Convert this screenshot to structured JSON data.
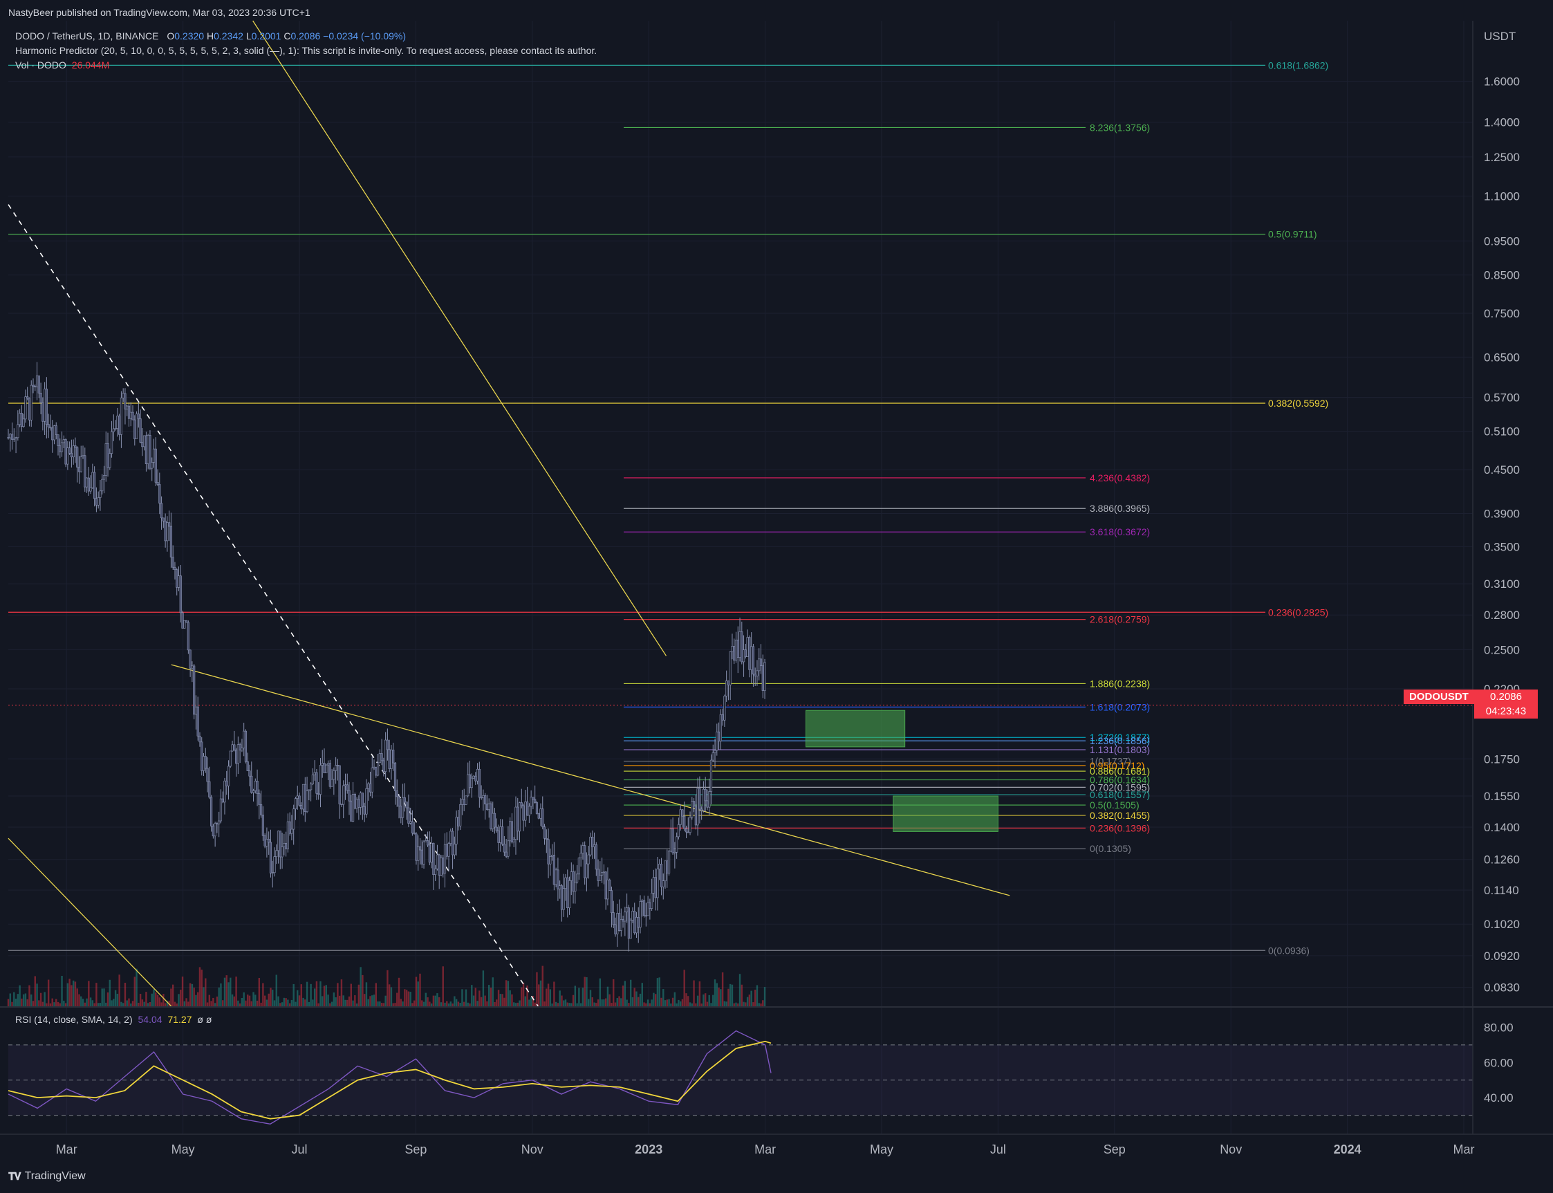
{
  "header": {
    "publish_line": "NastyBeer published on TradingView.com, Mar 03, 2023 20:36 UTC+1",
    "symbol_line": "DODO / TetherUS, 1D, BINANCE",
    "ohlc": {
      "o_label": "O",
      "o": "0.2320",
      "h_label": "H",
      "h": "0.2342",
      "l_label": "L",
      "l": "0.2001",
      "c_label": "C",
      "c": "0.2086",
      "chg": "−0.0234 (−10.09%)"
    },
    "indicator_line": "Harmonic Predictor (20, 5, 10, 0, 0, 5, 5, 5, 5, 5, 2, 3, solid (—), 1): This script is invite-only. To request access, please contact its author.",
    "vol_label": "Vol · DODO",
    "vol_value": "26.044M"
  },
  "rsi_legend": {
    "label": "RSI (14, close, SMA, 14, 2)",
    "rsi": "54.04",
    "sma": "71.27",
    "extra": "ø  ø"
  },
  "price_axis": {
    "currency": "USDT"
  },
  "last_price": {
    "symbol": "DODOUSDT",
    "price": "0.2086",
    "countdown": "04:23:43"
  },
  "footer": {
    "brand": "TradingView",
    "logo": "tradingview-logo-icon"
  },
  "colors": {
    "background": "#131722",
    "up": "#26a69a",
    "down": "#f23645",
    "candle_outline": "#8a93b2",
    "trendline": "#e8d44d",
    "rsi_line": "#7e57c2",
    "rsi_sma": "#f0d63c"
  },
  "chart_data": [
    {
      "type": "candlestick",
      "title": "DODO / TetherUS, 1D, BINANCE",
      "scale": "log",
      "ylim": [
        0.078,
        1.95
      ],
      "yticks": [
        1.6,
        1.4,
        1.25,
        1.1,
        0.95,
        0.85,
        0.75,
        0.65,
        0.57,
        0.51,
        0.45,
        0.39,
        0.35,
        0.31,
        0.28,
        0.25,
        0.22,
        0.175,
        0.155,
        0.14,
        0.126,
        0.114,
        0.102,
        0.092,
        0.083
      ],
      "ytick_labels": [
        "1.6000",
        "1.4000",
        "1.2500",
        "1.1000",
        "0.9500",
        "0.8500",
        "0.7500",
        "0.6500",
        "0.5700",
        "0.5100",
        "0.4500",
        "0.3900",
        "0.3500",
        "0.3100",
        "0.2800",
        "0.2500",
        "0.2200",
        "0.1750",
        "0.1550",
        "0.1400",
        "0.1260",
        "0.1140",
        "0.1020",
        "0.0920",
        "0.0830"
      ],
      "xtick_labels": [
        "Mar",
        "May",
        "Jul",
        "Sep",
        "Nov",
        "2023",
        "Mar",
        "May",
        "Jul",
        "Sep",
        "Nov",
        "2024",
        "Mar"
      ],
      "x_axis_months_from_feb_2022": [
        1,
        3,
        5,
        7,
        9,
        11,
        13,
        15,
        17,
        19,
        21,
        23,
        25
      ],
      "close_series_months": [
        0.0,
        0.5,
        1.0,
        1.5,
        2.0,
        2.5,
        3.0,
        3.5,
        4.0,
        4.5,
        5.0,
        5.5,
        6.0,
        6.5,
        7.0,
        7.5,
        8.0,
        8.5,
        9.0,
        9.5,
        10.0,
        10.5,
        11.0,
        11.5,
        12.0,
        12.5,
        13.0,
        13.1
      ],
      "close_series": [
        0.5,
        0.58,
        0.48,
        0.42,
        0.56,
        0.46,
        0.28,
        0.14,
        0.19,
        0.125,
        0.15,
        0.17,
        0.145,
        0.18,
        0.13,
        0.125,
        0.17,
        0.13,
        0.16,
        0.11,
        0.13,
        0.1,
        0.11,
        0.14,
        0.155,
        0.26,
        0.23,
        0.2086
      ],
      "fib_lines_long": [
        {
          "label": "0.618(1.6862)",
          "price": 1.6862,
          "color": "#26a69a"
        },
        {
          "label": "0.5(0.9711)",
          "price": 0.9711,
          "color": "#4caf50"
        },
        {
          "label": "0.382(0.5592)",
          "price": 0.5592,
          "color": "#f0d63c"
        },
        {
          "label": "0.236(0.2825)",
          "price": 0.2825,
          "color": "#f23645"
        },
        {
          "label": "0(0.0936)",
          "price": 0.0936,
          "color": "#787b86"
        }
      ],
      "fib_lines_short": [
        {
          "label": "8.236(1.3756)",
          "price": 1.3756,
          "color": "#4caf50"
        },
        {
          "label": "4.236(0.4382)",
          "price": 0.4382,
          "color": "#e91e63"
        },
        {
          "label": "3.886(0.3965)",
          "price": 0.3965,
          "color": "#b2b5be"
        },
        {
          "label": "3.618(0.3672)",
          "price": 0.3672,
          "color": "#9c27b0"
        },
        {
          "label": "2.618(0.2759)",
          "price": 0.2759,
          "color": "#f23645"
        },
        {
          "label": "1.886(0.2238)",
          "price": 0.2238,
          "color": "#cddc39"
        },
        {
          "label": "1.618(0.2073)",
          "price": 0.2073,
          "color": "#2962ff"
        },
        {
          "label": "1.272(0.1877)",
          "price": 0.1877,
          "color": "#00bcd4"
        },
        {
          "label": "1.236(0.1856)",
          "price": 0.1856,
          "color": "#5b9cf6"
        },
        {
          "label": "1.131(0.1803)",
          "price": 0.1803,
          "color": "#9575cd"
        },
        {
          "label": "1(0.1737)",
          "price": 0.1737,
          "color": "#787b86"
        },
        {
          "label": "0.95(0.1712)",
          "price": 0.1712,
          "color": "#ff9800"
        },
        {
          "label": "0.886(0.1681)",
          "price": 0.1681,
          "color": "#cddc39"
        },
        {
          "label": "0.786(0.1634)",
          "price": 0.1634,
          "color": "#4caf50"
        },
        {
          "label": "0.702(0.1595)",
          "price": 0.1595,
          "color": "#b2b5be"
        },
        {
          "label": "0.618(0.1557)",
          "price": 0.1557,
          "color": "#26a69a"
        },
        {
          "label": "0.5(0.1505)",
          "price": 0.1505,
          "color": "#4caf50"
        },
        {
          "label": "0.382(0.1455)",
          "price": 0.1455,
          "color": "#f0d63c"
        },
        {
          "label": "0.236(0.1396)",
          "price": 0.1396,
          "color": "#f23645"
        },
        {
          "label": "0(0.1305)",
          "price": 0.1305,
          "color": "#787b86"
        }
      ],
      "zones": [
        {
          "from_month": 13.7,
          "to_month": 15.4,
          "high": 0.205,
          "low": 0.182,
          "color": "#4caf50"
        },
        {
          "from_month": 15.2,
          "to_month": 17.0,
          "high": 0.155,
          "low": 0.138,
          "color": "#4caf50"
        }
      ]
    },
    {
      "type": "line",
      "title": "RSI (14, close, SMA, 14, 2)",
      "ylim": [
        20,
        90
      ],
      "ytick_labels": [
        "80.00",
        "60.00",
        "40.00"
      ],
      "yticks": [
        80,
        60,
        40
      ],
      "bands": [
        30,
        50,
        70
      ],
      "series": [
        {
          "name": "RSI",
          "values": [
            42,
            34,
            45,
            38,
            52,
            66,
            42,
            38,
            28,
            25,
            35,
            45,
            58,
            52,
            62,
            44,
            40,
            48,
            50,
            42,
            49,
            45,
            38,
            36,
            65,
            78,
            70,
            54
          ]
        },
        {
          "name": "SMA",
          "values": [
            44,
            40,
            41,
            40,
            44,
            58,
            50,
            42,
            32,
            28,
            30,
            40,
            50,
            54,
            56,
            50,
            45,
            46,
            48,
            46,
            47,
            46,
            42,
            38,
            55,
            68,
            72,
            71
          ]
        }
      ]
    }
  ]
}
